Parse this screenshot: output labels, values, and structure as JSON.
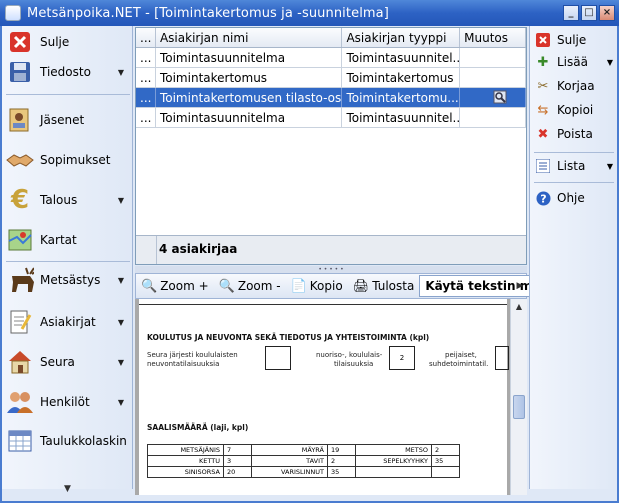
{
  "window": {
    "title": "Metsänpoika.NET - [Toimintakertomus ja -suunnitelma]"
  },
  "left_menu": [
    {
      "label": "Sulje",
      "icon": "close-icon",
      "arrow": false
    },
    {
      "label": "Tiedosto",
      "icon": "floppy-disk-icon",
      "arrow": true
    },
    {
      "label": "Jäsenet",
      "icon": "member-card-icon",
      "arrow": false
    },
    {
      "label": "Sopimukset",
      "icon": "handshake-icon",
      "arrow": false
    },
    {
      "label": "Talous",
      "icon": "euro-icon",
      "arrow": true
    },
    {
      "label": "Kartat",
      "icon": "map-icon",
      "arrow": false
    },
    {
      "label": "Metsästys",
      "icon": "moose-icon",
      "arrow": true
    },
    {
      "label": "Asiakirjat",
      "icon": "document-icon",
      "arrow": true
    },
    {
      "label": "Seura",
      "icon": "house-icon",
      "arrow": true
    },
    {
      "label": "Henkilöt",
      "icon": "people-icon",
      "arrow": true
    },
    {
      "label": "Taulukkolaskin",
      "icon": "spreadsheet-icon",
      "arrow": false
    }
  ],
  "grid": {
    "columns": [
      "...",
      "Asiakirjan nimi",
      "Asiakirjan tyyppi",
      "Muutos"
    ],
    "rows": [
      {
        "c0": "...",
        "name": "Toimintasuunnitelma",
        "type": "Toimintasuunnitel...",
        "edit": ""
      },
      {
        "c0": "...",
        "name": "Toimintakertomus",
        "type": "Toimintakertomus",
        "edit": ""
      },
      {
        "c0": "...",
        "name": "Toimintakertomusen tilasto-osa",
        "type": "Toimintakertomu...",
        "edit": "edit-icon"
      },
      {
        "c0": "...",
        "name": "Toimintasuunnitelma",
        "type": "Toimintasuunnitel...",
        "edit": ""
      }
    ],
    "count_label": "4 asiakirjaa"
  },
  "doc_toolbar": {
    "zoom_in": "Zoom +",
    "zoom_out": "Zoom -",
    "copy": "Kopio",
    "print": "Tulosta",
    "text_mode": "Käytä tekstin mu"
  },
  "document": {
    "section1_title": "KOULUTUS JA NEUVONTA SEKÄ TIEDOTUS JA YHTEISTOIMINTA (kpl)",
    "s1_left_1": "Seura järjesti koululaisten",
    "s1_left_2": "neuvontatilaisuuksia",
    "s1_mid_1": "nuoriso-, koululais-",
    "s1_mid_2": "tilaisuuksia",
    "s1_mid_value": "2",
    "s1_right_1": "peijaiset,",
    "s1_right_2": "suhdetoimintatil.",
    "section2_title": "SAALISMÄÄRÄ (laji, kpl)",
    "catch": [
      {
        "l1": "METSÄJÄNIS",
        "v1": "7",
        "l2": "MÄYRÄ",
        "v2": "19",
        "l3": "METSO",
        "v3": "2"
      },
      {
        "l1": "KETTU",
        "v1": "3",
        "l2": "TAVIT",
        "v2": "2",
        "l3": "SEPELKYYHKY",
        "v3": "35"
      },
      {
        "l1": "SINISORSA",
        "v1": "20",
        "l2": "VARISLINNUT",
        "v2": "35",
        "l3": "",
        "v3": ""
      }
    ]
  },
  "right_menu": {
    "close": "Sulje",
    "add": "Lisää",
    "edit": "Korjaa",
    "copy": "Kopioi",
    "delete": "Poista",
    "list": "Lista",
    "help": "Ohje"
  }
}
